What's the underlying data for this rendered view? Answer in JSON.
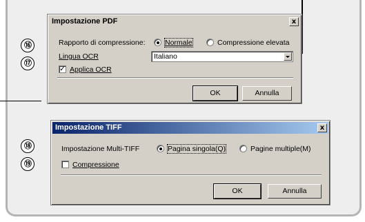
{
  "callouts": [
    "⑯",
    "⑰",
    "⑱",
    "⑲"
  ],
  "pdf_dialog": {
    "title": "Impostazione PDF",
    "close_label": "x",
    "compression_label": "Rapporto di compressione:",
    "radio_normal": "Normale",
    "radio_high": "Compressione elevata",
    "ocr_language_label": "Lingua OCR",
    "ocr_language_value": "Italiano",
    "apply_ocr_label": "Applica OCR",
    "apply_ocr_checked": true,
    "ok_label": "OK",
    "cancel_label": "Annulla"
  },
  "tiff_dialog": {
    "title": "Impostazione TIFF",
    "close_label": "x",
    "multitiff_label": "Impostazione Multi-TIFF",
    "radio_single": "Pagina singola(Q)",
    "radio_multi": "Pagine multiple(M)",
    "compression_label": "Compressione",
    "compression_checked": false,
    "ok_label": "OK",
    "cancel_label": "Annulla"
  },
  "colors": {
    "active_title": "#0a246a",
    "dialog_bg": "#d4d0c8",
    "panel_bg": "#eeeeee"
  }
}
